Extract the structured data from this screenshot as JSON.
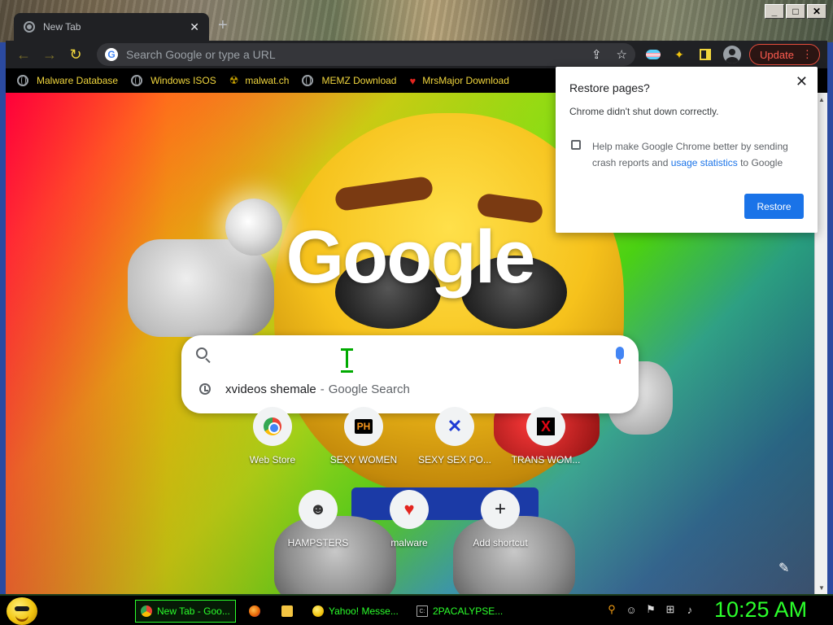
{
  "window": {
    "caption_buttons": [
      "minimize-icon",
      "maximize-icon",
      "close-icon"
    ]
  },
  "tab": {
    "title": "New Tab",
    "close_glyph": "✕",
    "new_tab_glyph": "+"
  },
  "toolbar": {
    "back_glyph": "←",
    "forward_glyph": "→",
    "reload_glyph": "↻",
    "omnibox_placeholder": "Search Google or type a URL",
    "share_glyph": "⇪",
    "star_glyph": "☆",
    "puzzle_glyph": "✦",
    "update_label": "Update",
    "menu_glyph": "⋮"
  },
  "bookmarks": [
    {
      "label": "Malware Database",
      "icon": "globe-icon"
    },
    {
      "label": "Windows ISOS",
      "icon": "globe-icon"
    },
    {
      "label": "malwat.ch",
      "icon": "radiation-icon"
    },
    {
      "label": "MEMZ Download",
      "icon": "globe-icon"
    },
    {
      "label": "MrsMajor Download",
      "icon": "heart-icon"
    }
  ],
  "ntp": {
    "logo": "Google",
    "search_placeholder": "",
    "suggestion": {
      "query": "xvideos shemale",
      "separator": "-",
      "source": "Google Search"
    },
    "shortcuts_row1": [
      {
        "label": "Web Store",
        "icon": "chrome-webstore-icon"
      },
      {
        "label": "SEXY WOMEN",
        "icon_text": "PH"
      },
      {
        "label": "SEXY SEX PO...",
        "icon_text": "✕"
      },
      {
        "label": "TRANS WOM...",
        "icon_text": "X"
      }
    ],
    "shortcuts_row2": [
      {
        "label": "HAMPSTERS",
        "icon_text": "☻"
      },
      {
        "label": "malware",
        "icon_text": "♥"
      },
      {
        "label": "Add shortcut",
        "icon_text": "+"
      }
    ],
    "customize_glyph": "✎"
  },
  "restore_popup": {
    "title": "Restore pages?",
    "message": "Chrome didn't shut down correctly.",
    "checkbox_pre": "Help make Google Chrome better by sending crash reports and ",
    "checkbox_link": "usage statistics",
    "checkbox_post": " to Google",
    "checked": false,
    "restore_label": "Restore",
    "close_glyph": "✕"
  },
  "taskbar": {
    "tasks": [
      {
        "label": "New Tab - Goo...",
        "icon": "chrome-icon",
        "active": true
      },
      {
        "label": "",
        "icon": "firefox-icon",
        "active": false
      },
      {
        "label": "",
        "icon": "folder-icon",
        "active": false
      },
      {
        "label": "Yahoo! Messe...",
        "icon": "yahoo-messenger-icon",
        "active": false
      },
      {
        "label": "2PACALYPSE...",
        "icon": "command-prompt-icon",
        "active": false
      }
    ],
    "tray_icons": [
      "search-icon",
      "emoji-icon",
      "flag-icon",
      "network-icon",
      "volume-icon"
    ],
    "clock": "10:25 AM"
  },
  "colors": {
    "accent_green": "#2bff2b",
    "toolbar_yellow": "#f1d63d",
    "update_red": "#ff5b4f",
    "restore_blue": "#1a73e8"
  }
}
